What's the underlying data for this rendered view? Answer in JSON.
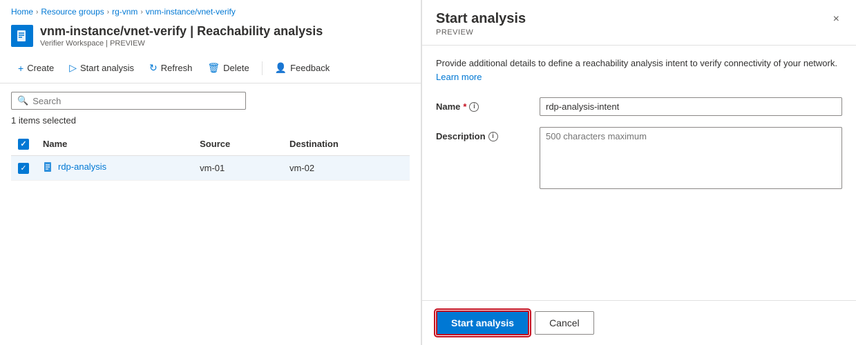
{
  "breadcrumb": {
    "home": "Home",
    "resource_groups": "Resource groups",
    "rg_vnm": "rg-vnm",
    "instance": "vnm-instance/vnet-verify"
  },
  "page": {
    "title": "vnm-instance/vnet-verify | Reachability analysis",
    "subtitle": "Verifier Workspace | PREVIEW"
  },
  "toolbar": {
    "create_label": "Create",
    "start_analysis_label": "Start analysis",
    "refresh_label": "Refresh",
    "delete_label": "Delete",
    "feedback_label": "Feedback"
  },
  "search": {
    "placeholder": "Search"
  },
  "items_selected": "1 items selected",
  "table": {
    "columns": [
      "Name",
      "Source",
      "Destination"
    ],
    "rows": [
      {
        "name": "rdp-analysis",
        "source": "vm-01",
        "destination": "vm-02",
        "checked": true
      }
    ]
  },
  "drawer": {
    "title": "Start analysis",
    "subtitle": "PREVIEW",
    "close_label": "×",
    "info_text": "Provide additional details to define a reachability analysis intent to verify connectivity of your network.",
    "learn_more": "Learn more",
    "name_label": "Name",
    "name_value": "rdp-analysis-intent",
    "description_label": "Description",
    "description_placeholder": "500 characters maximum",
    "start_btn": "Start analysis",
    "cancel_btn": "Cancel"
  },
  "colors": {
    "blue": "#0078d4",
    "red": "#c50f1f"
  }
}
